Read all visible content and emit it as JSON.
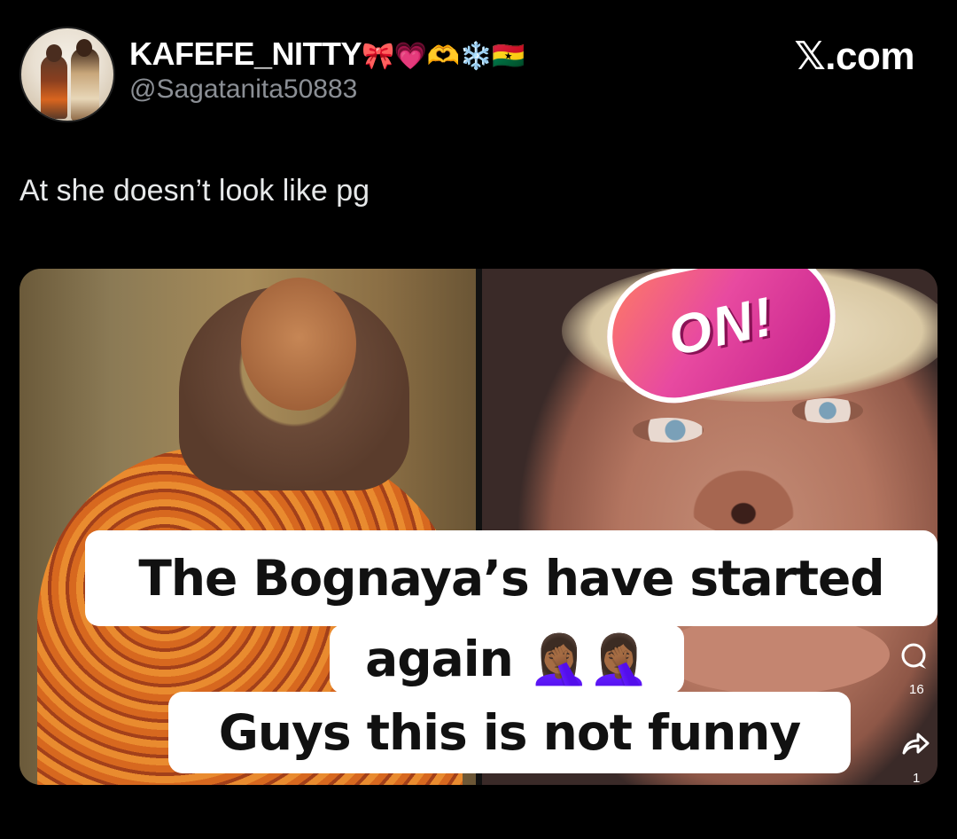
{
  "post": {
    "display_name": "KAFEFE_NITTY",
    "display_name_emojis": "🎀💗🫶❄️🇬🇭",
    "handle": "@Sagatanita50883",
    "text": "At she doesn’t look like pg"
  },
  "brand": "𝕏.com",
  "media": {
    "sticker_text": "ON!",
    "comment_count": "16",
    "share_count": "1",
    "comment_icon": "comment-bubble-icon",
    "share_icon": "share-arrow-icon"
  },
  "captions": {
    "line1": "The Bognaya’s have started",
    "line2": "again 🤦🏾‍♀️🤦🏾‍♀️",
    "line3": "Guys this is not funny"
  }
}
